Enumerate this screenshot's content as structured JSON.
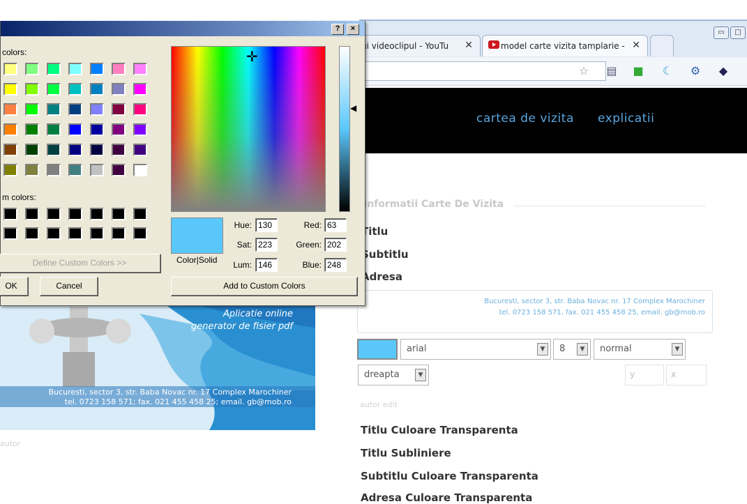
{
  "browser": {
    "tabs": [
      {
        "label": "gi videoclipul - YouTu"
      },
      {
        "label": "model carte vizita tamplarie -"
      }
    ],
    "nav": {
      "link1": "cartea de vizita",
      "link2": "explicatii"
    }
  },
  "form": {
    "legend": "Informatii Carte De Vizita",
    "fields": [
      "Titlu",
      "Subtitlu",
      "Adresa"
    ],
    "address_line1": "Bucuresti, sector 3, str. Baba Novac nr. 17 Complex Marochiner",
    "address_line2": "tel. 0723 158 571, fax. 021 455 458 25, email. gb@mob.ro",
    "font_select": "arial",
    "size_select": "8",
    "style_select": "normal",
    "align_select": "dreapta",
    "x_placeholder": "y",
    "y_placeholder": "x",
    "small_links": "autor  edit",
    "options": [
      "Titlu Culoare Transparenta",
      "Titlu Subliniere",
      "Subtitlu Culoare Transparenta",
      "Adresa Culoare Transparenta"
    ],
    "swatch_color": "#5ac7fb"
  },
  "card": {
    "title_line1": "Aplicatie online",
    "title_line2": "generator de fisier pdf",
    "addr_line1": "Bucuresti, sector 3, str. Baba Novac nr. 17 Complex Marochiner",
    "addr_line2": "tel. 0723 158 571; fax. 021 455 458 25; email. gb@mob.ro",
    "footer": "autor"
  },
  "dialog": {
    "help_label": "?",
    "close_label": "×",
    "basic_label": "colors:",
    "custom_label": "m colors:",
    "define_custom": "Define Custom Colors >>",
    "ok": "OK",
    "cancel": "Cancel",
    "add_custom": "Add to Custom Colors",
    "colorsolid": "Color|Solid",
    "hue_label": "Hue:",
    "hue": "130",
    "sat_label": "Sat:",
    "sat": "223",
    "lum_label": "Lum:",
    "lum": "146",
    "red_label": "Red:",
    "red": "63",
    "green_label": "Green:",
    "green": "202",
    "blue_label": "Blue:",
    "blue": "248",
    "basic_colors": [
      [
        "#ffff80",
        "#80ff80",
        "#00ff80",
        "#80ffff",
        "#0080ff",
        "#ff80c0",
        "#ff80ff"
      ],
      [
        "#ffff00",
        "#80ff00",
        "#00ff40",
        "#00c0c0",
        "#0080c0",
        "#8080c0",
        "#ff00ff"
      ],
      [
        "#ff8040",
        "#00ff00",
        "#008080",
        "#004080",
        "#8080ff",
        "#800040",
        "#ff0080"
      ],
      [
        "#ff8000",
        "#008000",
        "#008040",
        "#0000ff",
        "#0000a0",
        "#800080",
        "#8000ff"
      ],
      [
        "#804000",
        "#004000",
        "#004040",
        "#000080",
        "#000040",
        "#400040",
        "#400080"
      ],
      [
        "#808000",
        "#808040",
        "#808080",
        "#408080",
        "#c0c0c0",
        "#400040",
        "#ffffff"
      ]
    ]
  }
}
